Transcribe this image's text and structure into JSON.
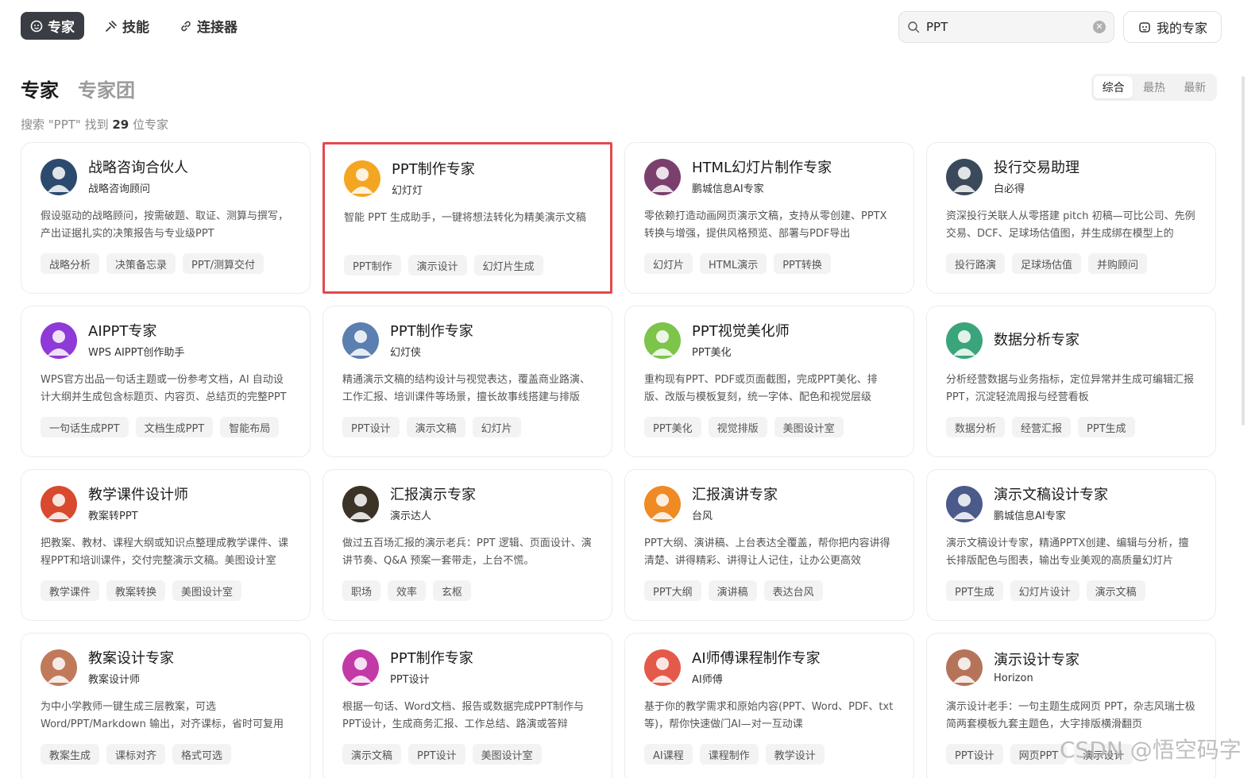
{
  "nav": {
    "tabs": [
      {
        "label": "专家",
        "icon": "expert-icon"
      },
      {
        "label": "技能",
        "icon": "skill-icon"
      },
      {
        "label": "连接器",
        "icon": "link-icon"
      }
    ]
  },
  "search": {
    "value": "PPT"
  },
  "my_expert": {
    "label": "我的专家",
    "icon": "robot-icon"
  },
  "section": {
    "tabs": [
      "专家",
      "专家团"
    ],
    "sort_options": [
      "综合",
      "最热",
      "最新"
    ],
    "result_prefix": "搜索 \"PPT\" 找到",
    "result_count": "29",
    "result_suffix": "位专家"
  },
  "cards": [
    {
      "title": "战略咨询合伙人",
      "subtitle": "战略咨询顾问",
      "desc": "假设驱动的战略顾问，按需破题、取证、测算与撰写，产出证据扎实的决策报告与专业级PPT",
      "tags": [
        "战略分析",
        "决策备忘录",
        "PPT/测算交付"
      ],
      "avatar": "man-suit-avatar",
      "color": "#2c4a6e"
    },
    {
      "title": "PPT制作专家",
      "subtitle": "幻灯灯",
      "desc": "智能 PPT 生成助手，一键将想法转化为精美演示文稿",
      "tags": [
        "PPT制作",
        "演示设计",
        "幻灯片生成"
      ],
      "avatar": "girl-avatar",
      "color": "#f4a623"
    },
    {
      "title": "HTML幻灯片制作专家",
      "subtitle": "鹏城信息AI专家",
      "desc": "零依赖打造动画网页演示文稿，支持从零创建、PPTX转换与增强，提供风格预览、部署与PDF导出",
      "tags": [
        "幻灯片",
        "HTML演示",
        "PPT转换"
      ],
      "avatar": "man-avatar",
      "color": "#7b3f6e"
    },
    {
      "title": "投行交易助理",
      "subtitle": "白必得",
      "desc": "资深投行关联人从零搭建 pitch 初稿—可比公司、先例交易、DCF、足球场估值图，并生成绑在模型上的",
      "tags": [
        "投行路演",
        "足球场估值",
        "并购顾问"
      ],
      "avatar": "man-glasses-avatar",
      "color": "#3a4a5a"
    },
    {
      "title": "AIPPT专家",
      "subtitle": "WPS AIPPT创作助手",
      "desc": "WPS官方出品一句话主题或一份参考文档，AI 自动设计大纲并生成包含标题页、内容页、总结页的完整PPT",
      "tags": [
        "一句话生成PPT",
        "文档生成PPT",
        "智能布局"
      ],
      "avatar": "aippt-logo",
      "color": "#8e3ad8"
    },
    {
      "title": "PPT制作专家",
      "subtitle": "幻灯侠",
      "desc": "精通演示文稿的结构设计与视觉表达，覆盖商业路演、工作汇报、培训课件等场景，擅长故事线搭建与排版",
      "tags": [
        "PPT设计",
        "演示文稿",
        "幻灯片"
      ],
      "avatar": "man-presenter-avatar",
      "color": "#5a7fb0"
    },
    {
      "title": "PPT视觉美化师",
      "subtitle": "PPT美化",
      "desc": "重构现有PPT、PDF或页面截图，完成PPT美化、排版、改版与模板复刻，统一字体、配色和视觉层级",
      "tags": [
        "PPT美化",
        "视觉排版",
        "美图设计室"
      ],
      "avatar": "frog-avatar",
      "color": "#7cc44a"
    },
    {
      "title": "数据分析专家",
      "subtitle": "",
      "desc": "分析经营数据与业务指标，定位异常并生成可编辑汇报PPT，沉淀轻流周报与经营看板",
      "tags": [
        "数据分析",
        "经营汇报",
        "PPT生成"
      ],
      "avatar": "analyst-avatar",
      "color": "#3aa57a"
    },
    {
      "title": "教学课件设计师",
      "subtitle": "教案转PPT",
      "desc": "把教案、教材、课程大纲或知识点整理成教学课件、课程PPT和培训课件，交付完整演示文稿。美图设计室",
      "tags": [
        "教学课件",
        "教案转换",
        "美图设计室"
      ],
      "avatar": "teacher-avatar",
      "color": "#d8492e"
    },
    {
      "title": "汇报演示专家",
      "subtitle": "演示达人",
      "desc": "做过五百场汇报的演示老兵：PPT 逻辑、页面设计、演讲节奏、Q&A 预案一套带走，上台不慌。",
      "tags": [
        "职场",
        "效率",
        "玄枢"
      ],
      "avatar": "disc-avatar",
      "color": "#3b3326"
    },
    {
      "title": "汇报演讲专家",
      "subtitle": "台风",
      "desc": "PPT大纲、演讲稿、上台表达全覆盖，帮你把内容讲得清楚、讲得精彩、讲得让人记住，让办公更高效",
      "tags": [
        "PPT大纲",
        "演讲稿",
        "表达台风"
      ],
      "avatar": "speaker-avatar",
      "color": "#f08a24"
    },
    {
      "title": "演示文稿设计专家",
      "subtitle": "鹏城信息AI专家",
      "desc": "演示文稿设计专家，精通PPTX创建、编辑与分析，擅长排版配色与图表，输出专业美观的高质量幻灯片",
      "tags": [
        "PPT生成",
        "幻灯片设计",
        "演示文稿"
      ],
      "avatar": "designer-avatar",
      "color": "#4a5a8a"
    },
    {
      "title": "教案设计专家",
      "subtitle": "教案设计师",
      "desc": "为中小学教师一键生成三层教案，可选Word/PPT/Markdown 输出，对齐课标，省时可复用",
      "tags": [
        "教案生成",
        "课标对齐",
        "格式可选"
      ],
      "avatar": "woman-avatar",
      "color": "#c07a5a"
    },
    {
      "title": "PPT制作专家",
      "subtitle": "PPT设计",
      "desc": "根据一句话、Word文档、报告或数据完成PPT制作与PPT设计，生成商务汇报、工作总结、路演或答辩",
      "tags": [
        "演示文稿",
        "PPT设计",
        "美图设计室"
      ],
      "avatar": "magician-avatar",
      "color": "#c23aa8"
    },
    {
      "title": "AI师傅课程制作专家",
      "subtitle": "AI师傅",
      "desc": "基于你的教学需求和原始内容(PPT、Word、PDF、txt等)，帮你快速做门AI—对一互动课",
      "tags": [
        "AI课程",
        "课程制作",
        "教学设计"
      ],
      "avatar": "robot-teacher-avatar",
      "color": "#e45a4a"
    },
    {
      "title": "演示设计专家",
      "subtitle": "Horizon",
      "desc": "演示设计老手：一句主题生成网页 PPT，杂志风瑞士极简两套模板九套主题色，大字排版横滑翻页",
      "tags": [
        "PPT设计",
        "网页PPT",
        "演示设计"
      ],
      "avatar": "young-man-avatar",
      "color": "#b5745a"
    }
  ],
  "watermark": "CSDN @悟空码字"
}
